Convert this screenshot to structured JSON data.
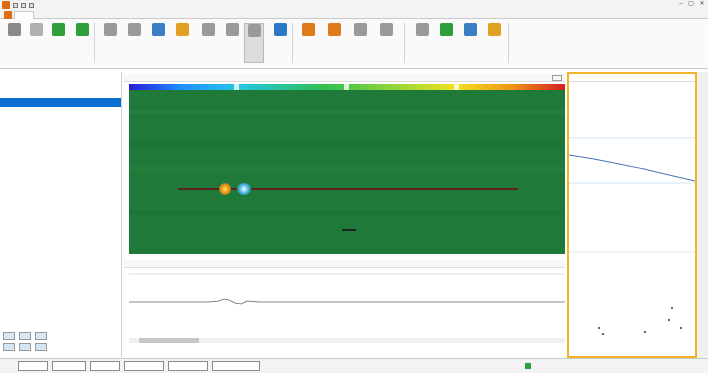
{
  "window": {
    "title": "",
    "controls": {
      "minimize": "–",
      "maximize": "▢",
      "close": "✕"
    }
  },
  "ribbon": {
    "tabs": [
      "",
      "",
      "",
      "",
      "",
      "",
      "",
      ""
    ],
    "groups": [
      {
        "icon": "search-icon",
        "color": "#8a8a8a",
        "label": ""
      },
      {
        "icon": "cursor-icon",
        "color": "#b0b0b0",
        "label": ""
      },
      {
        "icon": "go-icon",
        "color": "#2e9e3a",
        "label": ""
      },
      {
        "icon": "settings-icon",
        "color": "#2e9e3a",
        "label": ""
      },
      {
        "icon": "page-icon",
        "color": "#9a9a9a",
        "label": ""
      },
      {
        "icon": "zoom-icon",
        "color": "#9a9a9a",
        "label": ""
      },
      {
        "icon": "export-icon",
        "color": "#3a7fc6",
        "label": ""
      },
      {
        "icon": "report-icon",
        "color": "#e0a020",
        "label": ""
      },
      {
        "icon": "print-icon",
        "color": "#9a9a9a",
        "label": ""
      },
      {
        "icon": "pencil-icon",
        "color": "#9a9a9a",
        "label": ""
      },
      {
        "icon": "gate-icon",
        "color": "#9a9a9a",
        "label": ""
      },
      {
        "icon": "info-icon",
        "color": "#2a79c9",
        "label": ""
      },
      {
        "icon": "highlight-icon",
        "color": "#e07a1a",
        "label": ""
      },
      {
        "icon": "pointer-icon",
        "color": "#e07a1a",
        "label": ""
      },
      {
        "icon": "crosshair-icon",
        "color": "#9a9a9a",
        "label": ""
      },
      {
        "icon": "fullscreen-icon",
        "color": "#9a9a9a",
        "label": ""
      },
      {
        "icon": "pin-icon",
        "color": "#9a9a9a",
        "label": ""
      },
      {
        "icon": "camera-icon",
        "color": "#2e9e3a",
        "label": ""
      },
      {
        "icon": "table-icon",
        "color": "#3a7fc6",
        "label": ""
      },
      {
        "icon": "grid-icon",
        "color": "#e0a020",
        "label": ""
      }
    ]
  },
  "left": {
    "header": "",
    "tree": [
      "",
      "",
      ""
    ],
    "volume_label": "",
    "volume_buttons": [
      "",
      "",
      "",
      "",
      "",
      ""
    ]
  },
  "center": {
    "cscan_header": "",
    "ascan_header": "",
    "ascan_value": ""
  },
  "right": {
    "header": "",
    "header2": "",
    "chart_label": "",
    "chart2_label": ""
  },
  "status": {
    "boxes": [
      "",
      "",
      "",
      "",
      "",
      ""
    ],
    "right_text": ""
  },
  "colors": {
    "scan_bg": "#1f7a39",
    "accent_border": "#f0b429",
    "selection": "#0a6ed1"
  }
}
